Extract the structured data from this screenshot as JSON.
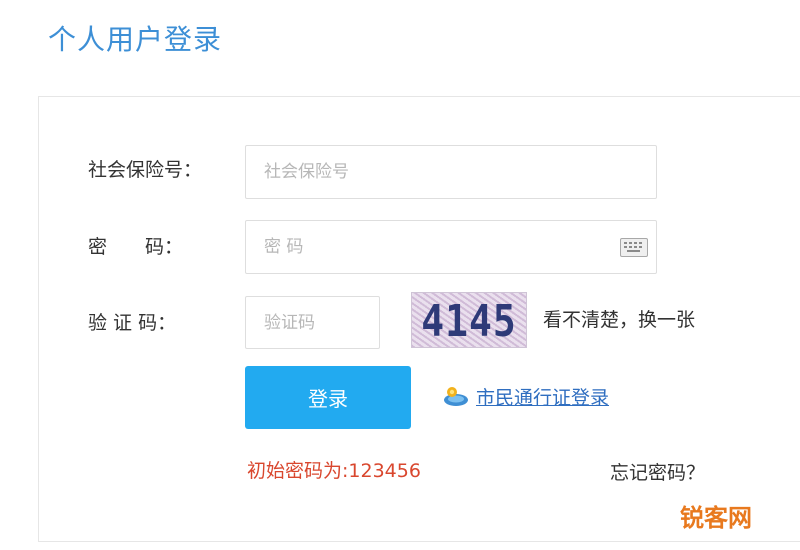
{
  "page_title": "个人用户登录",
  "form": {
    "ssn_label": "社会保险号：",
    "ssn_placeholder": "社会保险号",
    "password_label": "密　　码：",
    "password_placeholder": "密 码",
    "captcha_label": "验 证 码：",
    "captcha_placeholder": "验证码",
    "captcha_code": "4145",
    "captcha_refresh": "看不清楚，换一张",
    "login_button": "登录",
    "cert_link": "市民通行证登录",
    "initial_password_note": "初始密码为:123456",
    "forgot_password": "忘记密码？"
  },
  "icons": {
    "keyboard": "keyboard-icon",
    "cert": "citizen-pass-icon"
  },
  "colors": {
    "title": "#3d8fd6",
    "button": "#22aaf0",
    "link": "#2f6ec0",
    "notice": "#d9472e"
  },
  "watermark": "锐客网"
}
